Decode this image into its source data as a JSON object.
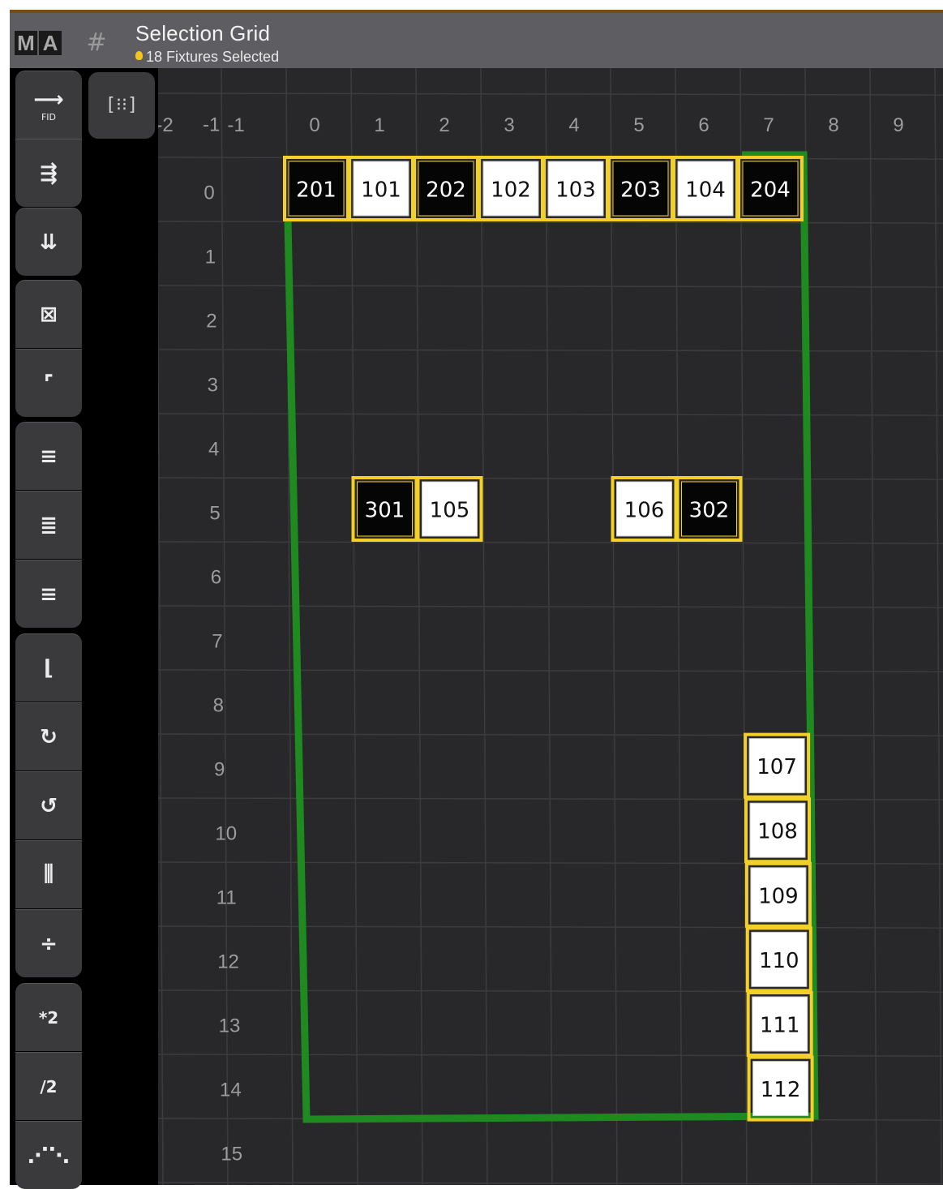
{
  "title": "Selection Grid",
  "subtitle": "18 Fixtures Selected",
  "logo": [
    "M",
    "A"
  ],
  "toolbar": {
    "buttons": [
      {
        "name": "fid-button",
        "glyph": "⟶",
        "sub": "FID"
      },
      {
        "name": "align-horizontal-button",
        "glyph": "⇶"
      },
      {
        "name": "align-vertical-button",
        "glyph": "⇊"
      },
      {
        "name": "compress-button",
        "glyph": "⊠"
      },
      {
        "name": "origin-button",
        "glyph": "⌜"
      },
      {
        "name": "align-left-button",
        "glyph": "≡"
      },
      {
        "name": "align-center-button",
        "glyph": "≣"
      },
      {
        "name": "align-right-button",
        "glyph": "≡"
      },
      {
        "name": "flip-button",
        "glyph": "⌊"
      },
      {
        "name": "rotate-cw-button",
        "glyph": "↻"
      },
      {
        "name": "rotate-ccw-button",
        "glyph": "↺"
      },
      {
        "name": "mirror-x-button",
        "glyph": "⫼"
      },
      {
        "name": "mirror-y-button",
        "glyph": "÷"
      },
      {
        "name": "multiply-button",
        "glyph": "*2"
      },
      {
        "name": "divide-button",
        "glyph": "/2"
      },
      {
        "name": "more-button",
        "glyph": "⋰⋱"
      }
    ],
    "side_button_glyph": "[⁝⁝]"
  },
  "grid": {
    "x_labels": [
      "-2",
      "-1",
      "0",
      "1",
      "2",
      "3",
      "4",
      "5",
      "6",
      "7",
      "8",
      "9"
    ],
    "y_labels": [
      "-1",
      "0",
      "1",
      "2",
      "3",
      "4",
      "5",
      "6",
      "7",
      "8",
      "9",
      "10",
      "11",
      "12",
      "13",
      "14",
      "15"
    ],
    "fixtures": [
      {
        "id": "201",
        "x": 0,
        "y": 0,
        "style": "black"
      },
      {
        "id": "101",
        "x": 1,
        "y": 0,
        "style": "white"
      },
      {
        "id": "202",
        "x": 2,
        "y": 0,
        "style": "black"
      },
      {
        "id": "102",
        "x": 3,
        "y": 0,
        "style": "white"
      },
      {
        "id": "103",
        "x": 4,
        "y": 0,
        "style": "white"
      },
      {
        "id": "203",
        "x": 5,
        "y": 0,
        "style": "black"
      },
      {
        "id": "104",
        "x": 6,
        "y": 0,
        "style": "white"
      },
      {
        "id": "204",
        "x": 7,
        "y": 0,
        "style": "black"
      },
      {
        "id": "301",
        "x": 1,
        "y": 5,
        "style": "black"
      },
      {
        "id": "105",
        "x": 2,
        "y": 5,
        "style": "white"
      },
      {
        "id": "106",
        "x": 5,
        "y": 5,
        "style": "white"
      },
      {
        "id": "302",
        "x": 6,
        "y": 5,
        "style": "black"
      },
      {
        "id": "107",
        "x": 7,
        "y": 9,
        "style": "white"
      },
      {
        "id": "108",
        "x": 7,
        "y": 10,
        "style": "white"
      },
      {
        "id": "109",
        "x": 7,
        "y": 11,
        "style": "white"
      },
      {
        "id": "110",
        "x": 7,
        "y": 12,
        "style": "white"
      },
      {
        "id": "111",
        "x": 7,
        "y": 13,
        "style": "white"
      },
      {
        "id": "112",
        "x": 7,
        "y": 14,
        "style": "white"
      }
    ],
    "selection_color": "#f2d027",
    "outline_color": "#1f8a1f"
  }
}
